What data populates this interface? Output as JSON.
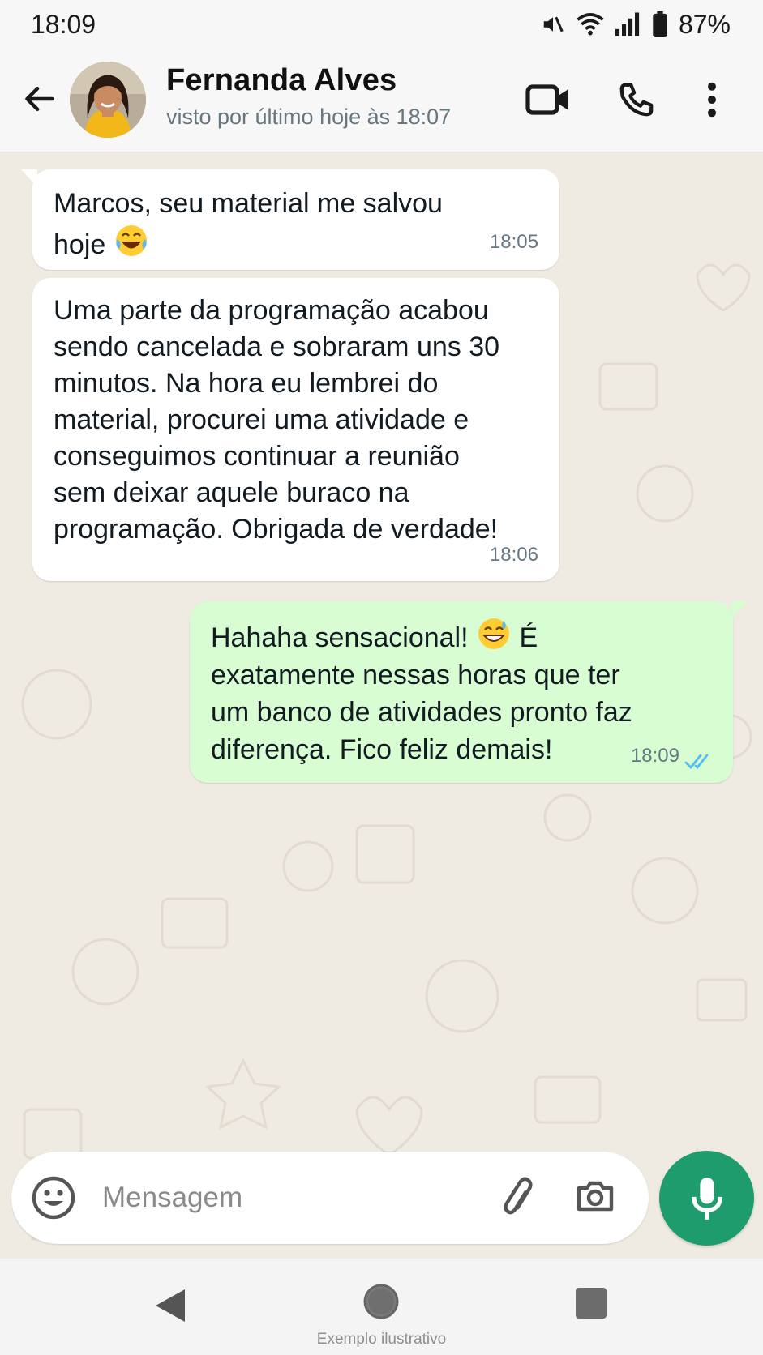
{
  "status_bar": {
    "time": "18:09",
    "battery": "87%",
    "icons": [
      "mute-icon",
      "wifi-icon",
      "signal-icon",
      "battery-icon"
    ]
  },
  "header": {
    "contact_name": "Fernanda Alves",
    "contact_status": "visto por último hoje às 18:07",
    "icons": [
      "back-arrow-icon",
      "video-call-icon",
      "phone-icon",
      "more-vert-icon"
    ]
  },
  "messages": [
    {
      "direction": "incoming",
      "lines": [
        "Marcos, seu material me salvou",
        "hoje"
      ],
      "emoji": "laughing-tears-emoji",
      "time": "18:05"
    },
    {
      "direction": "incoming",
      "lines": [
        "Uma parte da programação acabou",
        "sendo cancelada e sobraram uns 30",
        "minutos. Na hora eu lembrei do",
        "material, procurei uma atividade e",
        "conseguimos continuar a reunião",
        "sem deixar aquele buraco na",
        "programação. Obrigada de verdade!"
      ],
      "time": "18:06"
    },
    {
      "direction": "outgoing",
      "lines": [
        "Hahaha sensacional!",
        "É",
        "exatamente nessas horas que ter",
        "um banco de atividades pronto faz",
        "diferença. Fico feliz demais!"
      ],
      "emoji": "grinning-sweat-emoji",
      "time": "18:09",
      "read_status": "read"
    }
  ],
  "input": {
    "placeholder": "Mensagem"
  },
  "nav_bar": {
    "caption": "Exemplo ilustrativo"
  },
  "colors": {
    "accent": "#1f9c6e",
    "outgoing_bubble": "#d9fdd3",
    "incoming_bubble": "#ffffff",
    "chat_background": "#efeae2",
    "read_ticks": "#53bdeb"
  }
}
